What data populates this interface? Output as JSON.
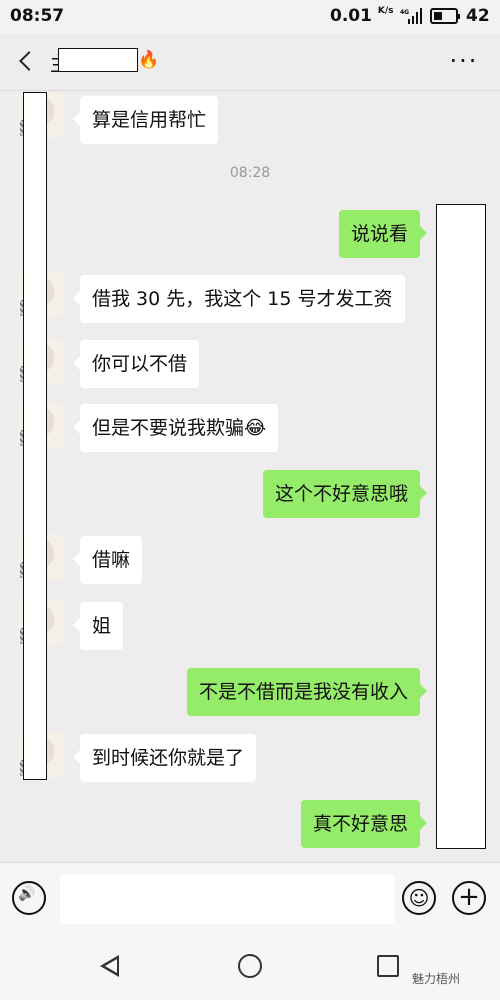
{
  "status_bar": {
    "time": "08:57",
    "network_speed": "0.01",
    "speed_unit": "K/s",
    "signal": "4G",
    "battery": "42"
  },
  "header": {
    "contact_name_prefix": "主",
    "fire_emoji": "🔥",
    "more": "···"
  },
  "chat": {
    "timestamp": "08:28",
    "messages": [
      {
        "side": "in",
        "text": "算是信用帮忙"
      },
      {
        "side": "out",
        "text": "说说看"
      },
      {
        "side": "in",
        "text": "借我 30 先，我这个 15 号才发工资"
      },
      {
        "side": "in",
        "text": "你可以不借"
      },
      {
        "side": "in",
        "text": "但是不要说我欺骗😂"
      },
      {
        "side": "out",
        "text": "这个不好意思哦"
      },
      {
        "side": "in",
        "text": "借嘛"
      },
      {
        "side": "in",
        "text": "姐"
      },
      {
        "side": "out",
        "text": "不是不借而是我没有收入"
      },
      {
        "side": "in",
        "text": "到时候还你就是了"
      },
      {
        "side": "out",
        "text": "真不好意思"
      }
    ]
  },
  "input_bar": {
    "emoji": "☺",
    "plus": "+"
  },
  "watermark": "魅力梧州",
  "colors": {
    "outgoing_bubble": "#95ec69",
    "incoming_bubble": "#ffffff",
    "background": "#ededed"
  }
}
